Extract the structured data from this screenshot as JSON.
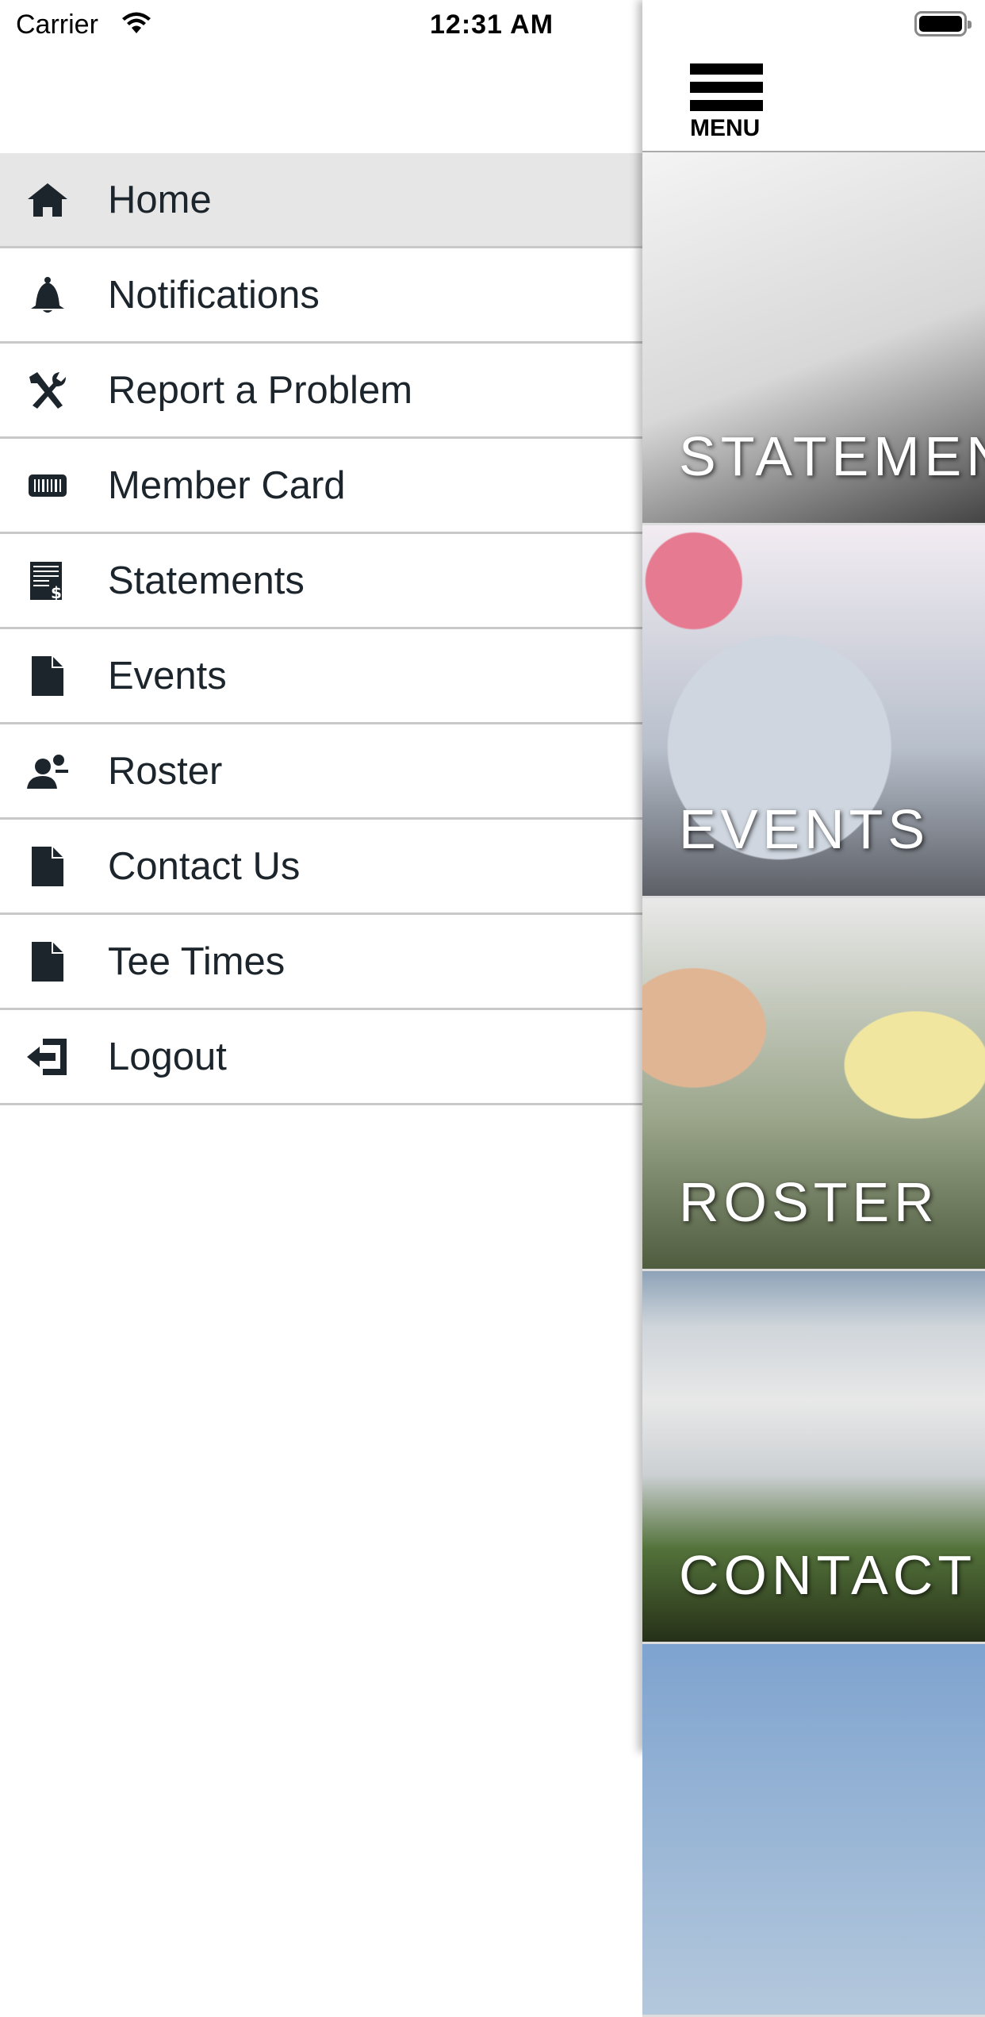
{
  "status_bar": {
    "carrier": "Carrier",
    "time": "12:31 AM"
  },
  "header": {
    "menu_label": "MENU"
  },
  "menu": {
    "items": [
      {
        "label": "Home",
        "icon": "home-icon",
        "active": true
      },
      {
        "label": "Notifications",
        "icon": "bell-icon"
      },
      {
        "label": "Report a Problem",
        "icon": "tools-icon"
      },
      {
        "label": "Member Card",
        "icon": "barcode-card-icon"
      },
      {
        "label": "Statements",
        "icon": "statement-dollar-icon"
      },
      {
        "label": "Events",
        "icon": "document-icon"
      },
      {
        "label": "Roster",
        "icon": "users-icon"
      },
      {
        "label": "Contact Us",
        "icon": "document-icon"
      },
      {
        "label": "Tee Times",
        "icon": "document-icon"
      },
      {
        "label": "Logout",
        "icon": "logout-icon"
      }
    ]
  },
  "tiles": [
    {
      "label": "STATEMENTS"
    },
    {
      "label": "EVENTS"
    },
    {
      "label": "ROSTER"
    },
    {
      "label": "CONTACT US"
    },
    {
      "label": ""
    }
  ],
  "colors": {
    "icon": "#1d252c",
    "active_row": "#e6e6e6"
  }
}
